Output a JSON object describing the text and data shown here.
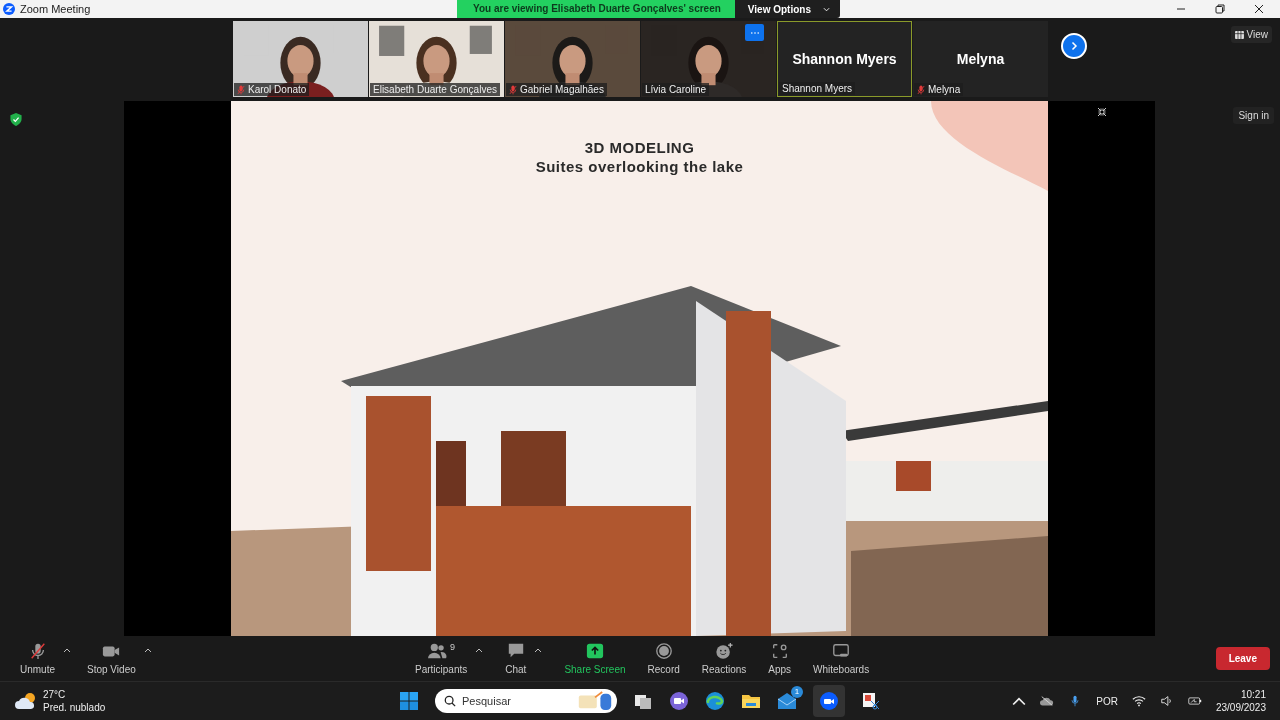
{
  "window": {
    "title": "Zoom Meeting"
  },
  "share_banner": {
    "text": "You are viewing Elisabeth Duarte Gonçalves' screen",
    "button": "View Options"
  },
  "participants": [
    {
      "name": "Karol Donato",
      "kind": "video",
      "muted": true,
      "speaking": false
    },
    {
      "name": "Elisabeth Duarte Gonçalves",
      "kind": "video",
      "muted": false,
      "speaking": false
    },
    {
      "name": "Gabriel Magalhães",
      "kind": "video",
      "muted": true,
      "speaking": false
    },
    {
      "name": "Lívia Caroline",
      "kind": "video",
      "muted": false,
      "speaking": false
    },
    {
      "name": "Shannon Myers",
      "display": "Shannon Myers",
      "kind": "name",
      "muted": false,
      "speaking": true
    },
    {
      "name": "Melyna",
      "display": "Melyna",
      "kind": "name",
      "muted": true,
      "speaking": false
    }
  ],
  "view_button": "View",
  "sign_in": "Sign in",
  "slide": {
    "title": "3D MODELING",
    "subtitle": "Suites overlooking the lake"
  },
  "toolbar": [
    {
      "label": "Unmute",
      "kind": "mic",
      "caret": true
    },
    {
      "label": "Stop Video",
      "kind": "video",
      "caret": true
    },
    {
      "label": "Participants",
      "kind": "participants",
      "count": "9",
      "caret": true
    },
    {
      "label": "Chat",
      "kind": "chat",
      "caret": true
    },
    {
      "label": "Share Screen",
      "kind": "share",
      "caret": false
    },
    {
      "label": "Record",
      "kind": "record",
      "caret": false
    },
    {
      "label": "Reactions",
      "kind": "reactions",
      "caret": false
    },
    {
      "label": "Apps",
      "kind": "apps",
      "caret": false
    },
    {
      "label": "Whiteboards",
      "kind": "whiteboards",
      "caret": false
    }
  ],
  "leave_button": "Leave",
  "taskbar": {
    "temperature": "27°C",
    "weather": "Pred. nublado",
    "search_placeholder": "Pesquisar",
    "mail_badge": "1",
    "language": "POR",
    "time": "10:21",
    "date": "23/09/2023"
  }
}
